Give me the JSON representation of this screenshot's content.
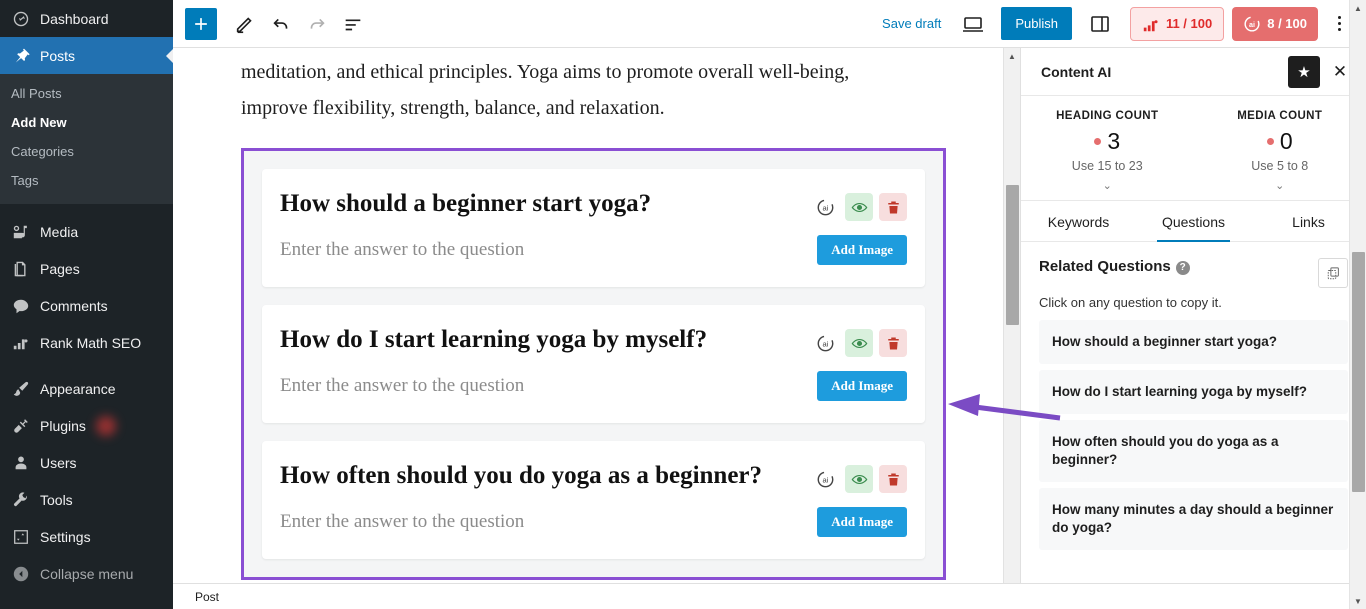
{
  "sidebar": {
    "items": [
      {
        "label": "Dashboard",
        "icon": "dashboard-icon",
        "active": false
      },
      {
        "label": "Posts",
        "icon": "pin-icon",
        "active": true
      },
      {
        "label": "Media",
        "icon": "media-icon",
        "active": false
      },
      {
        "label": "Pages",
        "icon": "pages-icon",
        "active": false
      },
      {
        "label": "Comments",
        "icon": "comments-icon",
        "active": false
      },
      {
        "label": "Rank Math SEO",
        "icon": "rankmath-icon",
        "active": false
      },
      {
        "label": "Appearance",
        "icon": "brush-icon",
        "active": false
      },
      {
        "label": "Plugins",
        "icon": "plug-icon",
        "active": false
      },
      {
        "label": "Users",
        "icon": "user-icon",
        "active": false
      },
      {
        "label": "Tools",
        "icon": "wrench-icon",
        "active": false
      },
      {
        "label": "Settings",
        "icon": "settings-icon",
        "active": false
      }
    ],
    "submenu": [
      {
        "label": "All Posts",
        "current": false
      },
      {
        "label": "Add New",
        "current": true
      },
      {
        "label": "Categories",
        "current": false
      },
      {
        "label": "Tags",
        "current": false
      }
    ],
    "collapse_label": "Collapse menu"
  },
  "toolbar": {
    "add_icon": "plus-icon",
    "edit_icon": "pencil-icon",
    "undo_icon": "undo-icon",
    "redo_icon": "redo-icon",
    "outline_icon": "document-outline-icon",
    "save_draft_label": "Save draft",
    "preview_icon": "preview-laptop-icon",
    "publish_label": "Publish",
    "settings_icon": "settings-sidebar-icon",
    "seo_score": "11 / 100",
    "seo_icon": "rankmath-score-icon",
    "ai_score": "8 / 100",
    "ai_icon": "content-ai-icon",
    "more_icon": "kebab-menu-icon",
    "accent_blue": "#007cba",
    "seo_badge_color": "#e02b2b",
    "ai_badge_color": "#e56e6e"
  },
  "editor": {
    "paragraph": "meditation, and ethical principles. Yoga aims to promote overall well-being, improve flexibility, strength, balance, and relaxation.",
    "annotation_color": "#8a4fd3",
    "faq_cards": [
      {
        "question": "How should a beginner start yoga?",
        "answer_placeholder": "Enter the answer to the question",
        "add_image_label": "Add Image"
      },
      {
        "question": "How do I start learning yoga by myself?",
        "answer_placeholder": "Enter the answer to the question",
        "add_image_label": "Add Image"
      },
      {
        "question": "How often should you do yoga as a beginner?",
        "answer_placeholder": "Enter the answer to the question",
        "add_image_label": "Add Image"
      }
    ],
    "card_actions": {
      "ai_icon": "content-ai-icon",
      "visibility_icon": "eye-icon",
      "delete_icon": "trash-icon"
    },
    "breadcrumb": "Post"
  },
  "panel": {
    "title": "Content AI",
    "star_icon": "star-icon",
    "close_icon": "close-icon",
    "counts": [
      {
        "label": "HEADING COUNT",
        "value": "3",
        "hint": "Use 15 to 23",
        "chevron": "chevron-down-icon"
      },
      {
        "label": "MEDIA COUNT",
        "value": "0",
        "hint": "Use 5 to 8",
        "chevron": "chevron-down-icon"
      }
    ],
    "tabs": [
      {
        "label": "Keywords",
        "active": false
      },
      {
        "label": "Questions",
        "active": true
      },
      {
        "label": "Links",
        "active": false
      }
    ],
    "related_questions_title": "Related Questions",
    "help_icon": "help-icon",
    "copy_icon": "copy-icon",
    "subtitle": "Click on any question to copy it.",
    "questions": [
      "How should a beginner start yoga?",
      "How do I start learning yoga by myself?",
      "How often should you do yoga as a beginner?",
      "How many minutes a day should a beginner do yoga?"
    ]
  }
}
